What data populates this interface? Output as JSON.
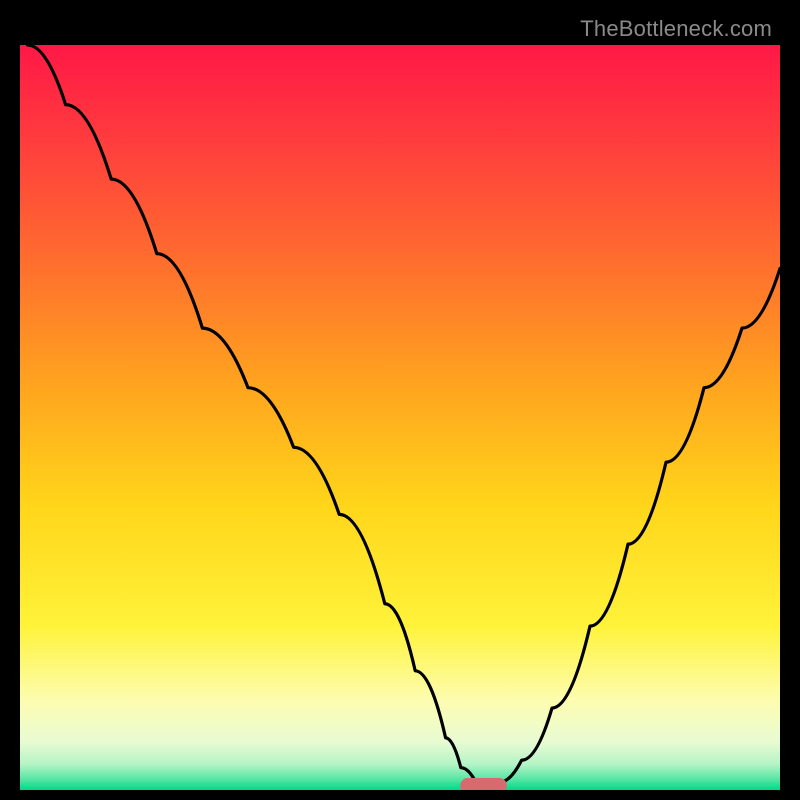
{
  "watermark": "TheBottleneck.com",
  "colors": {
    "gradient_stops": [
      {
        "offset": 0.0,
        "color": "#ff1846"
      },
      {
        "offset": 0.12,
        "color": "#ff3a3e"
      },
      {
        "offset": 0.28,
        "color": "#ff6a2f"
      },
      {
        "offset": 0.45,
        "color": "#ffa21f"
      },
      {
        "offset": 0.62,
        "color": "#ffd61a"
      },
      {
        "offset": 0.78,
        "color": "#fff33a"
      },
      {
        "offset": 0.88,
        "color": "#fdfdb0"
      },
      {
        "offset": 0.935,
        "color": "#e9fbd3"
      },
      {
        "offset": 0.965,
        "color": "#b6f4c6"
      },
      {
        "offset": 0.985,
        "color": "#59e6a4"
      },
      {
        "offset": 1.0,
        "color": "#00d989"
      }
    ],
    "curve": "#000000",
    "marker_fill": "#d66a6e",
    "marker_stroke": "#d66a6e",
    "background": "#000000"
  },
  "chart_data": {
    "type": "line",
    "title": "",
    "xlabel": "",
    "ylabel": "",
    "xlim": [
      0,
      100
    ],
    "ylim": [
      0,
      100
    ],
    "grid": false,
    "series": [
      {
        "name": "bottleneck-curve",
        "x": [
          1,
          6,
          12,
          18,
          24,
          30,
          36,
          42,
          48,
          52,
          56,
          58,
          60,
          63,
          66,
          70,
          75,
          80,
          85,
          90,
          95,
          100
        ],
        "values": [
          100,
          92,
          82,
          72,
          62,
          54,
          46,
          37,
          25,
          16,
          7,
          3,
          1,
          1,
          4,
          11,
          22,
          33,
          44,
          54,
          62,
          70
        ]
      }
    ],
    "marker": {
      "name": "optimal-range",
      "x_start": 58,
      "x_end": 64,
      "y": 0.6,
      "shape": "pill"
    }
  }
}
